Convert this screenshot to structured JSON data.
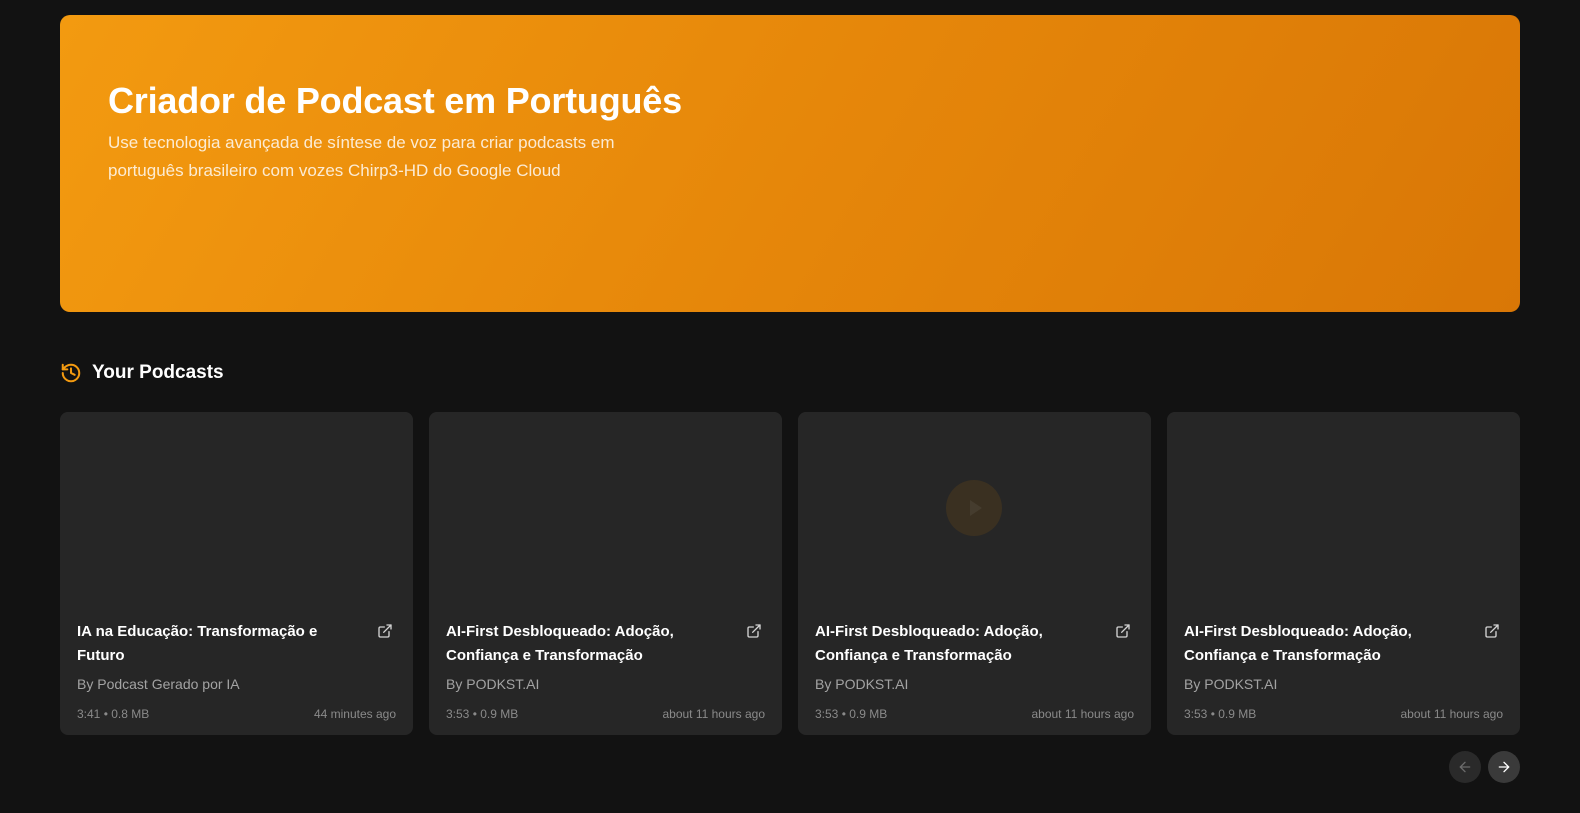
{
  "hero": {
    "title": "Criador de Podcast em Português",
    "subtitle": "Use tecnologia avançada de síntese de voz para criar podcasts em português brasileiro com vozes Chirp3-HD do Google Cloud",
    "accent": "#f39a10"
  },
  "section": {
    "title": "Your Podcasts",
    "icon": "history-icon",
    "icon_color": "#f39a10"
  },
  "podcasts": [
    {
      "title": "IA na Educação: Transformação e Futuro",
      "author": "By Podcast Gerado por IA",
      "duration_size": "3:41 • 0.8 MB",
      "time_ago": "44 minutes ago"
    },
    {
      "title": "AI-First Desbloqueado: Adoção, Confiança e Transformação",
      "author": "By PODKST.AI",
      "duration_size": "3:53 • 0.9 MB",
      "time_ago": "about 11 hours ago"
    },
    {
      "title": "AI-First Desbloqueado: Adoção, Confiança e Transformação",
      "author": "By PODKST.AI",
      "duration_size": "3:53 • 0.9 MB",
      "time_ago": "about 11 hours ago"
    },
    {
      "title": "AI-First Desbloqueado: Adoção, Confiança e Transformação",
      "author": "By PODKST.AI",
      "duration_size": "3:53 • 0.9 MB",
      "time_ago": "about 11 hours ago"
    }
  ],
  "carousel": {
    "prev_icon": "arrow-left-icon",
    "next_icon": "arrow-right-icon"
  }
}
